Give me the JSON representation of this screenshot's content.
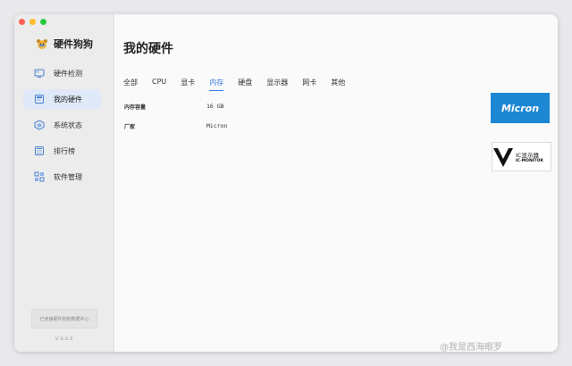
{
  "app": {
    "name": "硬件狗狗",
    "version": "V 0.0.3"
  },
  "sidebar": {
    "items": [
      {
        "label": "硬件检测",
        "icon": "monitor-icon",
        "active": false
      },
      {
        "label": "我的硬件",
        "icon": "hardware-icon",
        "active": true
      },
      {
        "label": "系统状态",
        "icon": "system-status-icon",
        "active": false
      },
      {
        "label": "排行榜",
        "icon": "ranking-icon",
        "active": false
      },
      {
        "label": "软件管理",
        "icon": "apps-grid-icon",
        "active": false
      }
    ],
    "sync_status": "已连接硬件狗狗数据中心"
  },
  "main": {
    "title": "我的硬件",
    "tabs": [
      {
        "label": "全部",
        "active": false
      },
      {
        "label": "CPU",
        "active": false
      },
      {
        "label": "显卡",
        "active": false
      },
      {
        "label": "内存",
        "active": true
      },
      {
        "label": "硬盘",
        "active": false
      },
      {
        "label": "显示器",
        "active": false
      },
      {
        "label": "网卡",
        "active": false
      },
      {
        "label": "其他",
        "active": false
      }
    ],
    "specs": [
      {
        "label": "内存容量",
        "value": "16 GB"
      },
      {
        "label": "厂家",
        "value": "Micron"
      }
    ],
    "logos": {
      "micron": {
        "text": "Micron",
        "color": "#1d87d4"
      },
      "ic_monitor": {
        "text_top": "IC显示器",
        "text_bottom": "IC·MONITOR"
      }
    }
  },
  "watermark": "@我是西海眼罗",
  "colors": {
    "accent": "#2f7ae5",
    "active_nav_bg": "#dfe9f8"
  }
}
